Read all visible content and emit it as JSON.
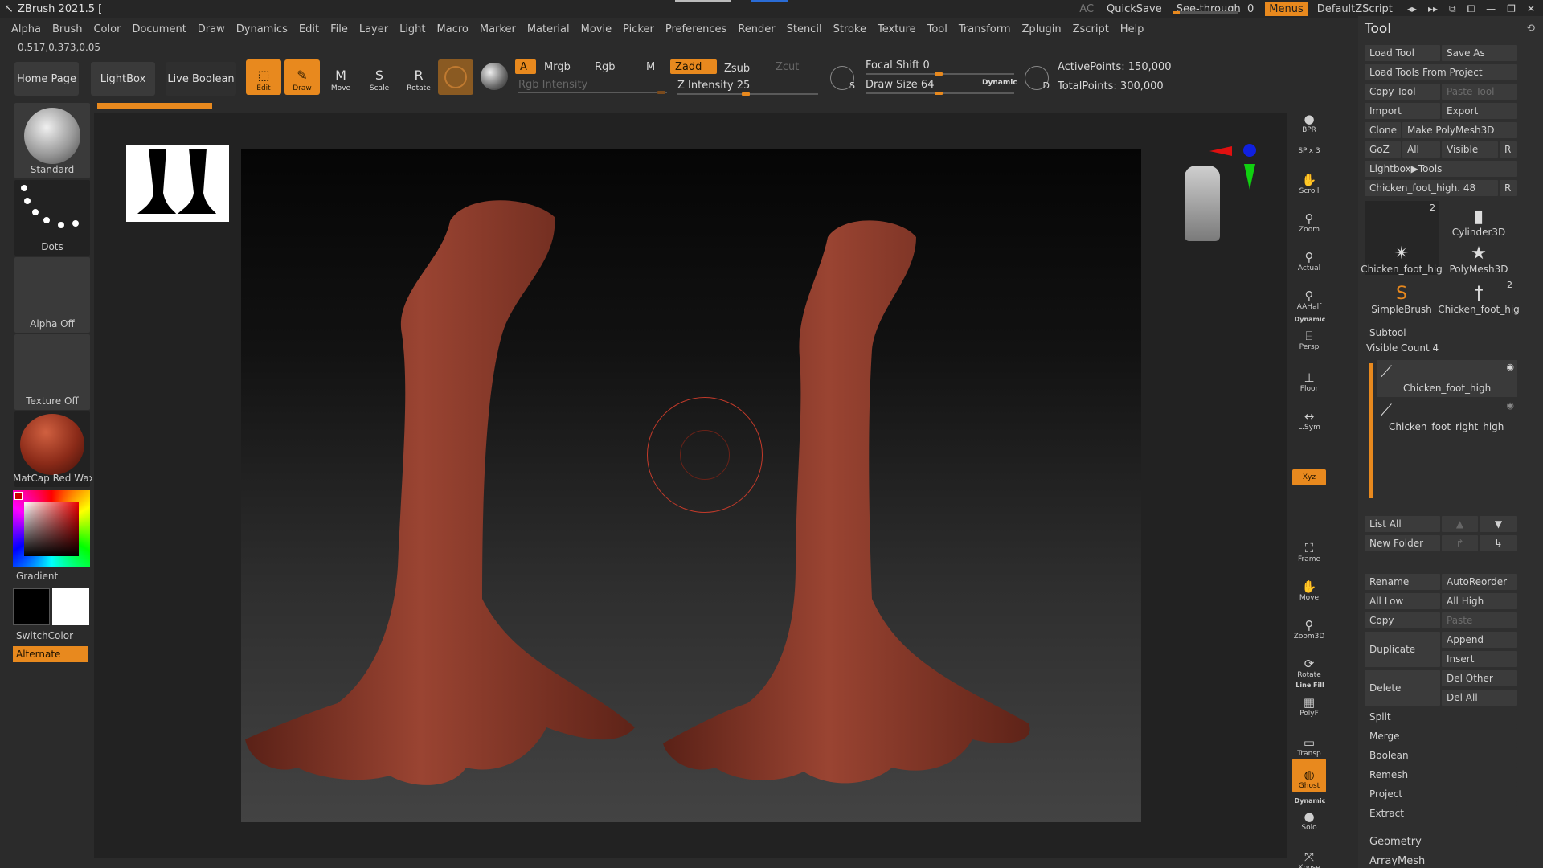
{
  "app": {
    "title": "ZBrush 2021.5 [",
    "ac": "AC",
    "quicksave": "QuickSave",
    "see_through_label": "See-through",
    "see_through_value": "0",
    "menus": "Menus",
    "script": "DefaultZScript"
  },
  "menubar": [
    "Alpha",
    "Brush",
    "Color",
    "Document",
    "Draw",
    "Dynamics",
    "Edit",
    "File",
    "Layer",
    "Light",
    "Macro",
    "Marker",
    "Material",
    "Movie",
    "Picker",
    "Preferences",
    "Render",
    "Stencil",
    "Stroke",
    "Texture",
    "Tool",
    "Transform",
    "Zplugin",
    "Zscript",
    "Help"
  ],
  "coords": "0.517,0.373,0.05",
  "shelf": {
    "home": "Home Page",
    "lightbox": "LightBox",
    "live_boolean": "Live Boolean",
    "tools": [
      {
        "label": "Edit",
        "icon": "edit-icon",
        "glyph": "⬚"
      },
      {
        "label": "Draw",
        "icon": "draw-icon",
        "glyph": "✎"
      },
      {
        "label": "Move",
        "icon": "move-icon",
        "glyph": "M"
      },
      {
        "label": "Scale",
        "icon": "scale-icon",
        "glyph": "S"
      },
      {
        "label": "Rotate",
        "icon": "rotate-icon",
        "glyph": "R"
      }
    ],
    "a_label": "A",
    "mrgb": "Mrgb",
    "rgb": "Rgb",
    "m": "M",
    "rgb_intensity": "Rgb Intensity",
    "zadd": "Zadd",
    "zsub": "Zsub",
    "zcut": "Zcut",
    "z_intensity_label": "Z Intensity",
    "z_intensity_value": "25",
    "focal_shift_label": "Focal Shift",
    "focal_shift_value": "0",
    "draw_size_label": "Draw Size",
    "draw_size_value": "64",
    "dynamic": "Dynamic",
    "s_label": "S",
    "d_label": "D",
    "active_points": "ActivePoints: 150,000",
    "total_points": "TotalPoints: 300,000"
  },
  "left": {
    "brush": "Standard",
    "stroke": "Dots",
    "alpha": "Alpha Off",
    "texture": "Texture Off",
    "material": "MatCap Red Wax",
    "gradient": "Gradient",
    "switchcolor": "SwitchColor",
    "alternate": "Alternate"
  },
  "rightstrip": {
    "bpr": "BPR",
    "spix": "SPix 3",
    "scroll": "Scroll",
    "zoom": "Zoom",
    "actual": "Actual",
    "aahalf": "AAHalf",
    "dynamic": "Dynamic",
    "persp": "Persp",
    "floor": "Floor",
    "lsym": "L.Sym",
    "xyz": "Xyz",
    "frame": "Frame",
    "move": "Move",
    "zoom3d": "Zoom3D",
    "rotate": "Rotate",
    "linefill": "Line Fill",
    "polyf": "PolyF",
    "transp": "Transp",
    "ghost": "Ghost",
    "solo_dynamic": "Dynamic",
    "solo": "Solo",
    "xpose": "Xpose"
  },
  "tool": {
    "title": "Tool",
    "load_tool": "Load Tool",
    "save_as": "Save As",
    "load_from_project": "Load Tools From Project",
    "copy_tool": "Copy Tool",
    "paste_tool": "Paste Tool",
    "import": "Import",
    "export": "Export",
    "clone": "Clone",
    "make_polymesh": "Make PolyMesh3D",
    "goz": "GoZ",
    "all": "All",
    "visible": "Visible",
    "r": "R",
    "lightbox_tools": "Lightbox▶Tools",
    "current_tool": "Chicken_foot_high. 48",
    "slots": [
      {
        "label": "Chicken_foot_hig",
        "badge": "2",
        "icon": "chicken-foot-icon",
        "glyph": "✴"
      },
      {
        "label": "Cylinder3D",
        "badge": "",
        "icon": "cylinder-icon",
        "glyph": "▮"
      },
      {
        "label": "PolyMesh3D",
        "badge": "",
        "icon": "star-icon",
        "glyph": "★"
      },
      {
        "label": "SimpleBrush",
        "badge": "",
        "icon": "simplebrush-icon",
        "glyph": "S"
      },
      {
        "label": "Chicken_foot_hig",
        "badge": "2",
        "icon": "chicken-foot-icon",
        "glyph": "†"
      }
    ],
    "subtool_header": "Subtool",
    "visible_count": "Visible Count 4",
    "subtools": [
      "Chicken_foot_high",
      "Chicken_foot_right_high"
    ],
    "list_all": "List All",
    "new_folder": "New Folder",
    "rename": "Rename",
    "autoreorder": "AutoReorder",
    "all_low": "All Low",
    "all_high": "All High",
    "copy": "Copy",
    "paste": "Paste",
    "duplicate": "Duplicate",
    "append": "Append",
    "insert": "Insert",
    "delete": "Delete",
    "del_other": "Del Other",
    "del_all": "Del All",
    "sections": [
      "Split",
      "Merge",
      "Boolean",
      "Remesh",
      "Project",
      "Extract"
    ],
    "geometry": "Geometry",
    "arraymesh": "ArrayMesh"
  },
  "colors": {
    "accent": "#e8891e",
    "model": "#8f3b2b",
    "panel": "#2f2f2f"
  }
}
